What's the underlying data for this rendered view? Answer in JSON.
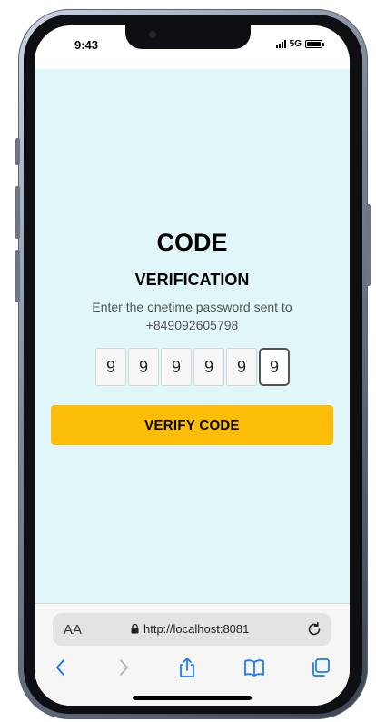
{
  "status": {
    "time": "9:43",
    "network": "5G"
  },
  "screen": {
    "title": "CODE",
    "subtitle": "VERIFICATION",
    "description_line1": "Enter the onetime password sent to",
    "description_line2": "+849092605798",
    "otp_digits": [
      "9",
      "9",
      "9",
      "9",
      "9",
      "9"
    ],
    "verify_label": "VERIFY CODE",
    "background_color": "#e0f6f8",
    "accent_color": "#fbbd07"
  },
  "browser": {
    "text_size_label": "AA",
    "url": "http://localhost:8081",
    "icons": [
      "back-icon",
      "forward-icon",
      "share-icon",
      "bookmarks-icon",
      "tabs-icon",
      "reload-icon",
      "lock-icon"
    ]
  }
}
